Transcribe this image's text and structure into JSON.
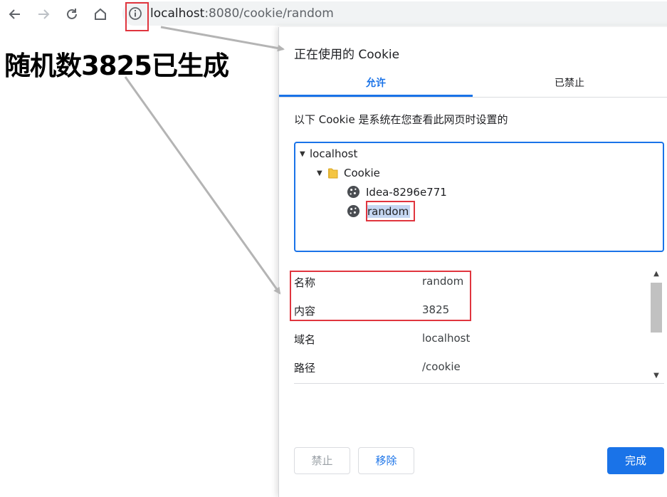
{
  "browser": {
    "url_host": "localhost",
    "url_rest": ":8080/cookie/random"
  },
  "page": {
    "heading": "随机数3825已生成"
  },
  "dialog": {
    "title": "正在使用的 Cookie",
    "tabs": [
      {
        "label": "允许",
        "active": true
      },
      {
        "label": "已禁止",
        "active": false
      }
    ],
    "description": "以下 Cookie 是系统在您查看此网页时设置的",
    "tree": {
      "site": "localhost",
      "folder": "Cookie",
      "cookies": [
        "Idea-8296e771",
        "random"
      ]
    },
    "details": [
      {
        "label": "名称",
        "value": "random"
      },
      {
        "label": "内容",
        "value": "3825"
      },
      {
        "label": "域名",
        "value": "localhost"
      },
      {
        "label": "路径",
        "value": "/cookie"
      }
    ],
    "buttons": {
      "block": "禁止",
      "remove": "移除",
      "done": "完成"
    }
  },
  "colors": {
    "accent": "#1a73e8",
    "highlight": "#e0353e"
  }
}
